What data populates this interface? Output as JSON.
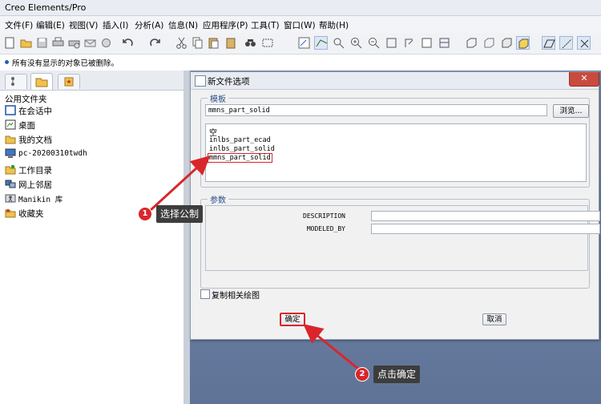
{
  "app": {
    "title": "Creo Elements/Pro"
  },
  "menu": [
    "文件(F)",
    "编辑(E)",
    "视图(V)",
    "插入(I)",
    "分析(A)",
    "信息(N)",
    "应用程序(P)",
    "工具(T)",
    "窗口(W)",
    "帮助(H)"
  ],
  "message_bar": {
    "text": "所有没有显示的对象已被删除。"
  },
  "left_panel": {
    "section_title": "公用文件夹",
    "folders": [
      {
        "label": "在会话中",
        "icon": "session-icon"
      },
      {
        "label": "桌面",
        "icon": "desktop-icon"
      },
      {
        "label": "我的文档",
        "icon": "documents-folder-icon"
      },
      {
        "label": "pc-20200310twdh",
        "icon": "computer-icon"
      },
      {
        "label": "工作目录",
        "icon": "working-directory-icon"
      },
      {
        "label": "网上邻居",
        "icon": "network-icon"
      },
      {
        "label": "Manikin 库",
        "icon": "manikin-library-icon"
      },
      {
        "label": "收藏夹",
        "icon": "favorites-icon"
      }
    ]
  },
  "dialog": {
    "title": "新文件选项",
    "template_section": {
      "legend": "模板",
      "current_value": "mmns_part_solid",
      "browse_label": "浏览...",
      "templates": [
        "空",
        "inlbs_part_ecad",
        "inlbs_part_solid",
        "mmns_part_solid"
      ],
      "highlighted_template": "mmns_part_solid"
    },
    "parameters_section": {
      "legend": "参数",
      "params": [
        {
          "name": "DESCRIPTION",
          "value": ""
        },
        {
          "name": "MODELED_BY",
          "value": ""
        }
      ]
    },
    "copy_drawings_label": "复制相关绘图",
    "copy_drawings_checked": false,
    "ok_label": "确定",
    "cancel_label": "取消"
  },
  "annotations": [
    {
      "number": "1",
      "text": "选择公制"
    },
    {
      "number": "2",
      "text": "点击确定"
    }
  ],
  "colors": {
    "highlight": "#d9262b",
    "graphics_bg": "#6b7fa3",
    "legend_text": "#2b4f8a"
  }
}
